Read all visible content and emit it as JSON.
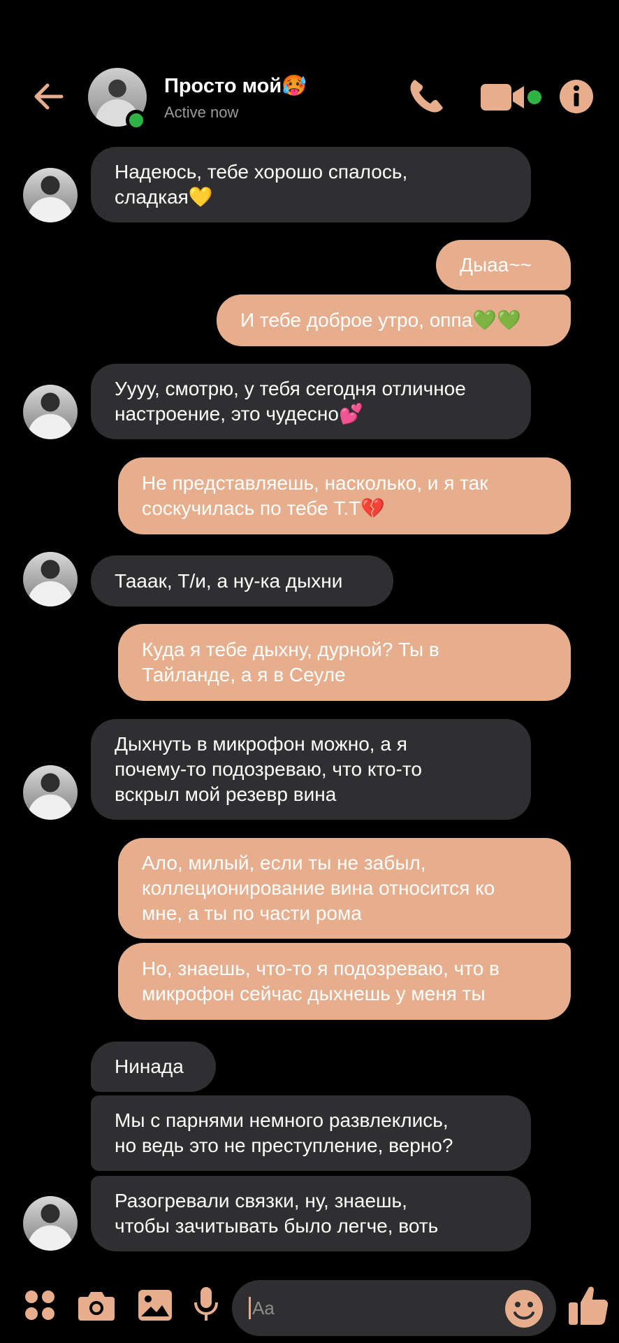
{
  "header": {
    "contact_name": "Просто мой🥵",
    "status": "Active now"
  },
  "accent_color": "#e6ae8c",
  "online_color": "#2fb344",
  "messages": [
    {
      "from": "them",
      "text": "Надеюсь, тебе хорошо спалось,\nсладкая💛"
    },
    {
      "from": "me",
      "text": "Дыаа~~"
    },
    {
      "from": "me",
      "text": "И тебе доброе утро, оппа💚💚"
    },
    {
      "from": "them",
      "text": "Уууу, смотрю, у тебя сегодня отличное\nнастроение, это чудесно💕"
    },
    {
      "from": "me",
      "text": "Не представляешь, насколько, и я так\nсоскучилась по тебе Т.Т💔"
    },
    {
      "from": "them",
      "text": "Тааак, Т/и, а ну-ка дыхни"
    },
    {
      "from": "me",
      "text": "Куда я тебе дыхну, дурной? Ты в\nТайланде, а я в Сеуле"
    },
    {
      "from": "them",
      "text": "Дыхнуть в микрофон можно, а я\nпочему-то подозреваю, что кто-то\nвскрыл мой резевр вина"
    },
    {
      "from": "me",
      "text": "Ало, милый, если ты не забыл,\nколлеционирование вина относится ко\nмне, а ты по части рома"
    },
    {
      "from": "me",
      "text": "Но, знаешь, что-то я подозреваю, что в\nмикрофон сейчас дыхнешь у меня ты"
    },
    {
      "from": "them",
      "text": "Нинада"
    },
    {
      "from": "them",
      "text": "Мы с парнями немного развлеклись,\nно ведь это не преступление, верно?"
    },
    {
      "from": "them",
      "text": "Разогревали связки, ну, знаешь,\nчтобы зачитывать было легче, воть"
    }
  ],
  "composer": {
    "placeholder": "Aa",
    "icons": [
      "apps-icon",
      "camera-icon",
      "gallery-icon",
      "mic-icon",
      "emoji-icon",
      "thumbs-up-icon"
    ]
  }
}
